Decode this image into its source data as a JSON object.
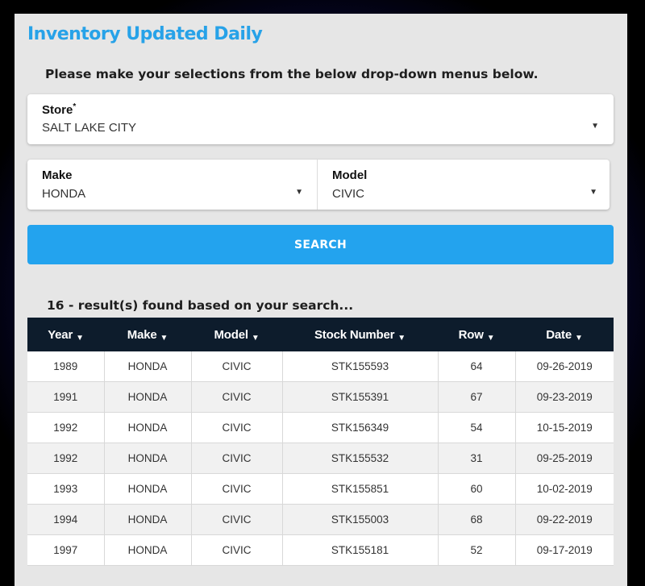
{
  "page": {
    "title": "Inventory Updated Daily",
    "instructions": "Please make your selections from the below drop-down menus below."
  },
  "filters": {
    "store": {
      "label": "Store",
      "required_mark": "*",
      "value": "SALT LAKE CITY"
    },
    "make": {
      "label": "Make",
      "value": "HONDA"
    },
    "model": {
      "label": "Model",
      "value": "CIVIC"
    },
    "caret_glyph": "▼"
  },
  "search": {
    "label": "SEARCH"
  },
  "results": {
    "summary": "16 - result(s) found based on your search...",
    "columns": [
      "Year",
      "Make",
      "Model",
      "Stock Number",
      "Row",
      "Date"
    ],
    "rows": [
      [
        "1989",
        "HONDA",
        "CIVIC",
        "STK155593",
        "64",
        "09-26-2019"
      ],
      [
        "1991",
        "HONDA",
        "CIVIC",
        "STK155391",
        "67",
        "09-23-2019"
      ],
      [
        "1992",
        "HONDA",
        "CIVIC",
        "STK156349",
        "54",
        "10-15-2019"
      ],
      [
        "1992",
        "HONDA",
        "CIVIC",
        "STK155532",
        "31",
        "09-25-2019"
      ],
      [
        "1993",
        "HONDA",
        "CIVIC",
        "STK155851",
        "60",
        "10-02-2019"
      ],
      [
        "1994",
        "HONDA",
        "CIVIC",
        "STK155003",
        "68",
        "09-22-2019"
      ],
      [
        "1997",
        "HONDA",
        "CIVIC",
        "STK155181",
        "52",
        "09-17-2019"
      ]
    ]
  },
  "colors": {
    "accent": "#27a2e8",
    "button": "#23a3ee",
    "table_header": "#0d1c2c",
    "panel": "#e6e6e6"
  }
}
